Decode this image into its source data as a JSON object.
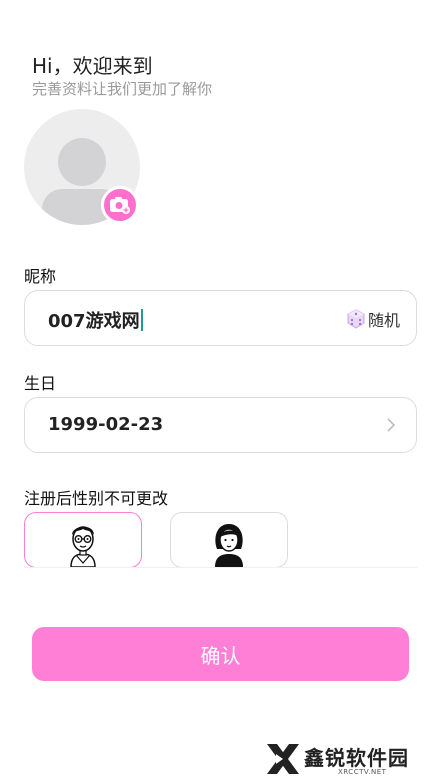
{
  "header": {
    "greeting": "Hi，欢迎来到",
    "subtitle": "完善资料让我们更加了解你"
  },
  "avatar": {
    "icon": "person-placeholder-icon",
    "camera_icon": "camera-add-icon",
    "camera_color": "#ff6fce"
  },
  "nickname": {
    "label": "昵称",
    "value": "007游戏网",
    "random_label": "随机",
    "random_icon": "dice-icon"
  },
  "birthday": {
    "label": "生日",
    "value": "1999-02-23",
    "icon": "chevron-right-icon"
  },
  "gender": {
    "label": "注册后性别不可更改",
    "options": [
      {
        "id": "male",
        "icon": "male-avatar-icon",
        "selected": true
      },
      {
        "id": "female",
        "icon": "female-avatar-icon",
        "selected": false
      }
    ]
  },
  "confirm": {
    "label": "确认",
    "color": "#ff7fd6"
  },
  "watermark": {
    "name": "鑫锐软件园",
    "url": "XRCCTV.NET"
  }
}
